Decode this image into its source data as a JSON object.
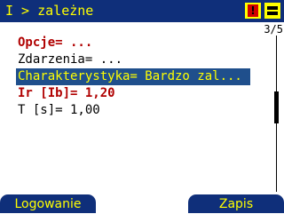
{
  "header": {
    "title": "I > zależne",
    "icons": [
      "alarm-icon",
      "bus-icon"
    ],
    "alarm_mark": "!",
    "colors": {
      "background": "#0f2f7a",
      "text": "#ffff00",
      "alarm": "#d00000"
    }
  },
  "page_counter": "3/5",
  "scroll_position": 0.45,
  "menu": {
    "items": [
      {
        "label": "Opcje= ...",
        "style": "accent"
      },
      {
        "label": "Zdarzenia= ...",
        "style": "normal"
      },
      {
        "label": "Charakterystyka= Bardzo zal...",
        "style": "selected"
      },
      {
        "label": "Ir [Ib]= 1,20",
        "style": "accent"
      },
      {
        "label": "T [s]= 1,00",
        "style": "normal"
      }
    ],
    "colors": {
      "accent": "#b00000",
      "selected_bg": "#1f4f8c",
      "selected_text": "#ffff00"
    }
  },
  "softkeys": {
    "left_label": "Logowanie",
    "right_label": "Zapis"
  }
}
